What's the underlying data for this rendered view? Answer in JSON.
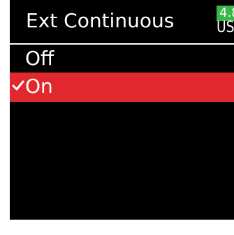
{
  "header": {
    "title": "Ext Continuous",
    "battery": {
      "level_text": "4.8",
      "source": "USB",
      "icon": "battery-icon"
    }
  },
  "options": [
    {
      "label": "Off",
      "selected": false
    },
    {
      "label": "On",
      "selected": true,
      "icon": "check-icon"
    }
  ],
  "colors": {
    "background": "#000000",
    "selection": "#e0282e",
    "battery": "#39b54a",
    "text": "#ffffff"
  }
}
